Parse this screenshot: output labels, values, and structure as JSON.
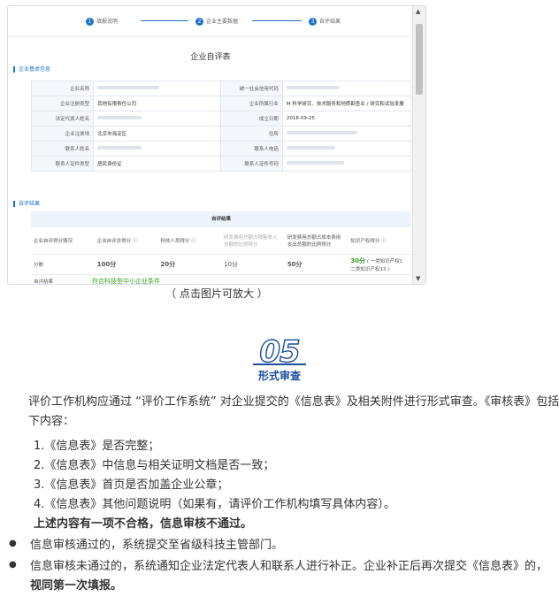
{
  "steps": [
    "填报说明",
    "企业主要数据",
    "自评结果"
  ],
  "form_title": "企业自评表",
  "section_basic": "企业基本信息",
  "info_rows": [
    {
      "l1": "企业名称",
      "v1": "",
      "l2": "统一社会信用代码",
      "v2": ""
    },
    {
      "l1": "企业注册类型",
      "v1": "其他有限责任公司",
      "l2": "企业所属行业",
      "v2": "M 科学研究、技术服务和地质勘查业 / 研究和试验发展"
    },
    {
      "l1": "法定代表人姓名",
      "v1": "",
      "l2": "成立日期",
      "v2": "2018-09-25"
    },
    {
      "l1": "企业注册地",
      "v1": "北京市海淀区",
      "l2": "住所",
      "v2": ""
    },
    {
      "l1": "联系人姓名",
      "v1": "",
      "l2": "联系人电话",
      "v2": ""
    },
    {
      "l1": "联系人证件类型",
      "v1": "居民身份证",
      "l2": "联系人证件号码",
      "v2": ""
    }
  ],
  "section_result": "自评结果",
  "result": {
    "head": "自评结果",
    "cols": [
      "企业自评得分情况",
      "企业自评总得分 ⓘ",
      "科技人员得分 ⓘ",
      "研发费用总额占销售收入总额的比例得分",
      "研发费用总额占成本费用支出总额的比例得分",
      "知识产权得分 ⓘ"
    ],
    "score_label": "分数",
    "scores": [
      "100分",
      "20分",
      "10分",
      "50分",
      "30分"
    ],
    "ip_note": "( 一类知识产权1 二类知识产权13 )",
    "conclusion_label": "自评结果",
    "conclusion": "符合科技型中小企业条件"
  },
  "caption": "（ 点击图片可放大 ）",
  "logo_num": "05",
  "logo_label": "形式审查",
  "para1": "评价工作机构应通过 “评价工作系统” 对企业提交的《信息表》及相关附件进行形式审查。《审核表》包括以下内容：",
  "items": [
    "1.《信息表》是否完整；",
    "2.《信息表》中信息与相关证明文档是否一致；",
    "3.《信息表》首页是否加盖企业公章；",
    "4.《信息表》其他问题说明（如果有，请评价工作机构填写具体内容）。"
  ],
  "warn": "上述内容有一项不合格，信息审核不通过。",
  "bullet1": "信息审核通过的，系统提交至省级科技主管部门。",
  "bullet2_a": "信息审核未通过的，系统通知企业法定代表人和联系人进行补正。企业补正后再次提交《信息表》的，",
  "bullet2_b": "视同第一次填报。"
}
